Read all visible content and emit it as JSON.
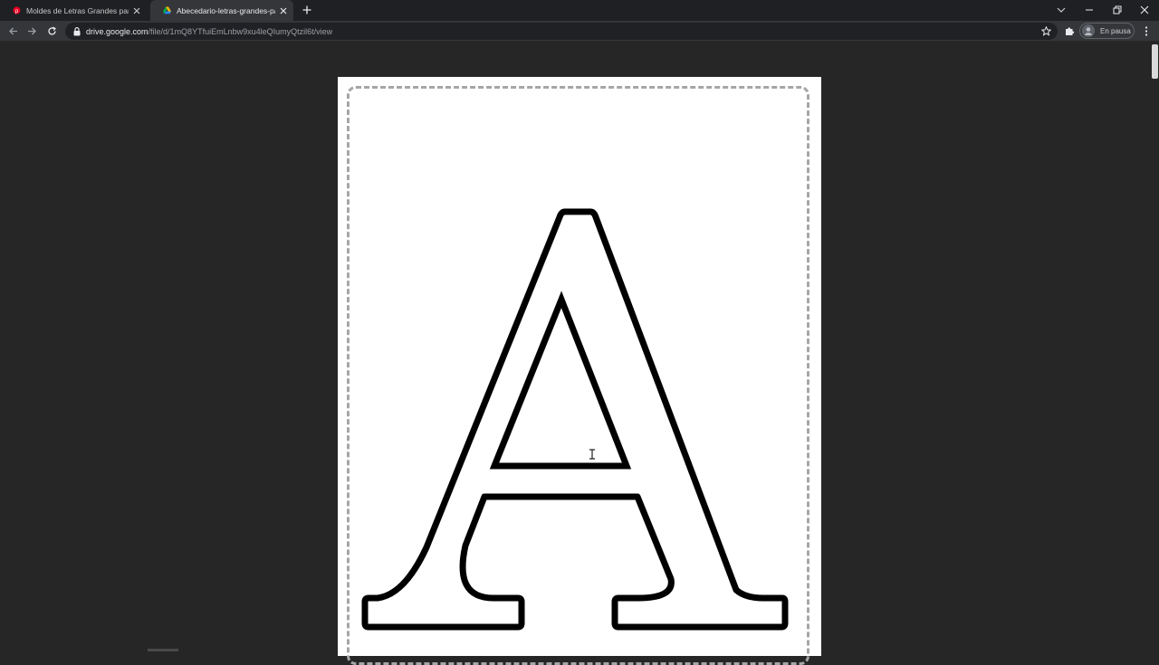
{
  "tabs": [
    {
      "title": "Moldes de Letras Grandes para I",
      "active": false,
      "favicon": "pinterest-favicon-icon"
    },
    {
      "title": "Abecedario-letras-grandes-para-",
      "active": true,
      "favicon": "google-drive-favicon-icon"
    }
  ],
  "toolbar": {
    "url_host": "drive.google.com",
    "url_path": "/file/d/1mQ8YTfuiEmLnbw9xu4leQIumyQtzil6t/view",
    "profile_label": "En pausa"
  },
  "document": {
    "letter": "A",
    "stroke_color": "#000000",
    "border_color": "#a6a6a6"
  },
  "colors": {
    "tabstrip_bg": "#1f2023",
    "toolbar_bg": "#35363a",
    "viewer_bg": "#262626"
  }
}
